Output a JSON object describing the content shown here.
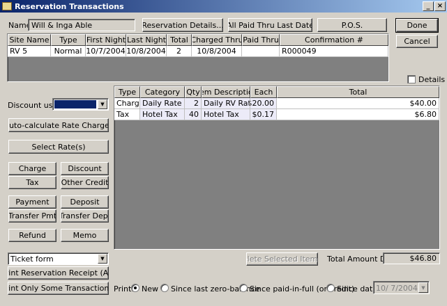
{
  "window": {
    "title": "Reservation Transactions",
    "minimize": "_",
    "close": "×"
  },
  "name": {
    "label": "Name:",
    "value": "Will & Inga Able"
  },
  "top_buttons": {
    "reservation_details": "Reservation Details...",
    "all_paid_thru": "All Paid Thru Last Date",
    "pos": "P.O.S.",
    "done": "Done",
    "cancel": "Cancel"
  },
  "sites_table": {
    "columns": [
      "Site Name",
      "Type",
      "First Night",
      "Last Night",
      "Total",
      "Charged Thru",
      "Paid Thru",
      "Confirmation #"
    ],
    "rows": [
      [
        "RV 5",
        "Normal",
        "10/7/2004",
        "10/8/2004",
        "2",
        "10/8/2004",
        "",
        "R000049"
      ]
    ]
  },
  "details_checkbox": {
    "label": "Details",
    "checked": false
  },
  "discount": {
    "label": "Discount used:",
    "value": ""
  },
  "left_buttons": {
    "auto_calc": "Auto-calculate Rate Charges",
    "select_rates": "Select Rate(s)",
    "charge": "Charge",
    "discount": "Discount",
    "tax": "Tax",
    "other_credit": "Other Credit",
    "payment": "Payment",
    "deposit": "Deposit",
    "transfer_pmt": "Transfer Pmt",
    "transfer_dep": "Transfer Dep.",
    "refund": "Refund",
    "memo": "Memo"
  },
  "transactions_table": {
    "columns": [
      "Type",
      "Category",
      "Qty",
      "Item Description",
      "Each",
      "Total"
    ],
    "rows": [
      [
        "Charge",
        "Daily Rate",
        "2",
        "Daily RV Rate",
        "$20.00",
        "$40.00"
      ],
      [
        "Tax",
        "Hotel Tax",
        "40",
        "Hotel Tax",
        "$0.17",
        "$6.80"
      ]
    ]
  },
  "ticket_form": {
    "value": "Ticket form"
  },
  "print_buttons": {
    "print_receipt": "Print Reservation Receipt (All)",
    "print_some": "Print Only Some Transactions:"
  },
  "delete_button": "Delete Selected Item(s)",
  "total": {
    "label": "Total Amount Due:",
    "value": "$46.80"
  },
  "print_options": {
    "label": "Print:",
    "options": [
      "New",
      "Since last zero-balance",
      "Since paid-in-full (or credit)",
      "Since date:"
    ],
    "selected": "New",
    "date_value": "10/ 7/2004"
  },
  "colors": {
    "titlebar": "#0a246a",
    "face": "#d4d0c8",
    "grid_bg": "#808080",
    "selection": "#0a246a"
  }
}
